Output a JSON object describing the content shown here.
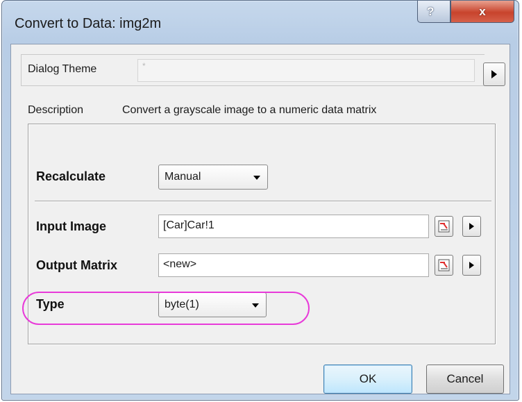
{
  "window": {
    "title": "Convert to Data: img2m",
    "help_glyph": "?",
    "close_glyph": "x"
  },
  "theme": {
    "label": "Dialog Theme",
    "value": "*"
  },
  "description": {
    "label": "Description",
    "text": "Convert a grayscale image to a numeric data matrix"
  },
  "recalculate": {
    "label": "Recalculate",
    "value": "Manual"
  },
  "input_image": {
    "label": "Input Image",
    "value": "[Car]Car!1"
  },
  "output_matrix": {
    "label": "Output Matrix",
    "value": "<new>"
  },
  "type": {
    "label": "Type",
    "value": "byte(1)"
  },
  "buttons": {
    "ok": "OK",
    "cancel": "Cancel"
  },
  "colors": {
    "highlight": "#e83ad9",
    "close_button": "#c8432c",
    "title_bar": "#b8cde6"
  },
  "icons": {
    "help": "help-icon",
    "close": "close-icon",
    "arrow": "triangle-right-icon",
    "picker": "range-picker-icon",
    "dropdown": "chevron-down-icon"
  }
}
